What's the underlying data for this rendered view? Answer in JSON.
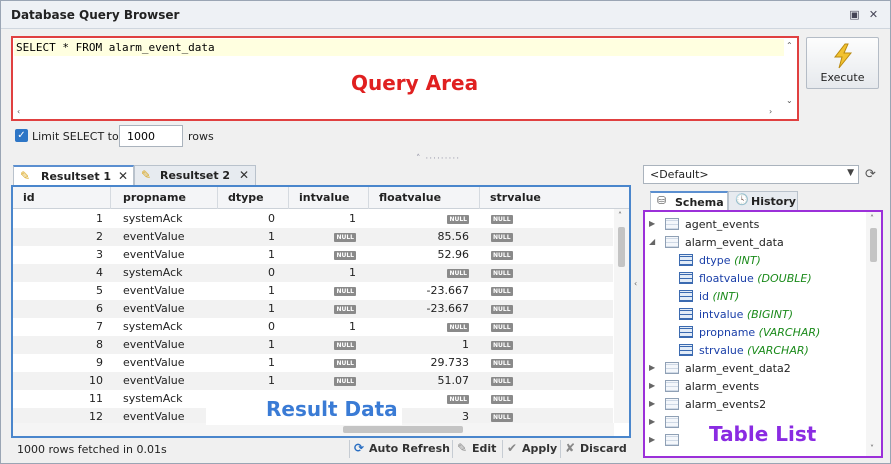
{
  "window": {
    "title": "Database Query Browser"
  },
  "query": {
    "text": "SELECT * FROM alarm_event_data",
    "area_label": "Query Area",
    "area_label_color": "#e02020"
  },
  "execute": {
    "label": "Execute"
  },
  "limit": {
    "label": "Limit SELECT to:",
    "value": "1000",
    "suffix": "rows"
  },
  "tabs": [
    {
      "label": "Resultset 1"
    },
    {
      "label": "Resultset 2"
    }
  ],
  "grid": {
    "columns": [
      "id",
      "propname",
      "dtype",
      "intvalue",
      "floatvalue",
      "strvalue"
    ],
    "null_text": "NULL",
    "overlay_label": "Result Data",
    "overlay_color": "#3a7bd5",
    "rows": [
      {
        "id": "1",
        "propname": "systemAck",
        "dtype": "0",
        "intvalue": "1",
        "floatvalue": null,
        "strvalue": null
      },
      {
        "id": "2",
        "propname": "eventValue",
        "dtype": "1",
        "intvalue": null,
        "floatvalue": "85.56",
        "strvalue": null
      },
      {
        "id": "3",
        "propname": "eventValue",
        "dtype": "1",
        "intvalue": null,
        "floatvalue": "52.96",
        "strvalue": null
      },
      {
        "id": "4",
        "propname": "systemAck",
        "dtype": "0",
        "intvalue": "1",
        "floatvalue": null,
        "strvalue": null
      },
      {
        "id": "5",
        "propname": "eventValue",
        "dtype": "1",
        "intvalue": null,
        "floatvalue": "-23.667",
        "strvalue": null
      },
      {
        "id": "6",
        "propname": "eventValue",
        "dtype": "1",
        "intvalue": null,
        "floatvalue": "-23.667",
        "strvalue": null
      },
      {
        "id": "7",
        "propname": "systemAck",
        "dtype": "0",
        "intvalue": "1",
        "floatvalue": null,
        "strvalue": null
      },
      {
        "id": "8",
        "propname": "eventValue",
        "dtype": "1",
        "intvalue": null,
        "floatvalue": "1",
        "strvalue": null
      },
      {
        "id": "9",
        "propname": "eventValue",
        "dtype": "1",
        "intvalue": null,
        "floatvalue": "29.733",
        "strvalue": null
      },
      {
        "id": "10",
        "propname": "eventValue",
        "dtype": "1",
        "intvalue": null,
        "floatvalue": "51.07",
        "strvalue": null
      },
      {
        "id": "11",
        "propname": "systemAck",
        "dtype": "",
        "intvalue": "",
        "floatvalue": null,
        "strvalue": null
      },
      {
        "id": "12",
        "propname": "eventValue",
        "dtype": "",
        "intvalue": "",
        "floatvalue": "3",
        "strvalue": null
      }
    ]
  },
  "status": {
    "text": "1000 rows fetched in 0.01s",
    "auto_refresh": "Auto Refresh",
    "edit": "Edit",
    "apply": "Apply",
    "discard": "Discard"
  },
  "schema_select": {
    "value": "<Default>"
  },
  "right_tabs": [
    {
      "label": "Schema"
    },
    {
      "label": "History"
    }
  ],
  "tree": {
    "overlay_label": "Table List",
    "overlay_color": "#8a2be2",
    "items": [
      {
        "kind": "table",
        "name": "agent_events",
        "expanded": false
      },
      {
        "kind": "table",
        "name": "alarm_event_data",
        "expanded": true
      },
      {
        "kind": "column",
        "name": "dtype",
        "type": "(INT)"
      },
      {
        "kind": "column",
        "name": "floatvalue",
        "type": "(DOUBLE)"
      },
      {
        "kind": "column",
        "name": "id",
        "type": "(INT)"
      },
      {
        "kind": "column",
        "name": "intvalue",
        "type": "(BIGINT)"
      },
      {
        "kind": "column",
        "name": "propname",
        "type": "(VARCHAR)"
      },
      {
        "kind": "column",
        "name": "strvalue",
        "type": "(VARCHAR)"
      },
      {
        "kind": "table",
        "name": "alarm_event_data2",
        "expanded": false
      },
      {
        "kind": "table",
        "name": "alarm_events",
        "expanded": false
      },
      {
        "kind": "table",
        "name": "alarm_events2",
        "expanded": false
      },
      {
        "kind": "table",
        "name": "",
        "expanded": false
      },
      {
        "kind": "table",
        "name": "",
        "expanded": false
      }
    ]
  }
}
